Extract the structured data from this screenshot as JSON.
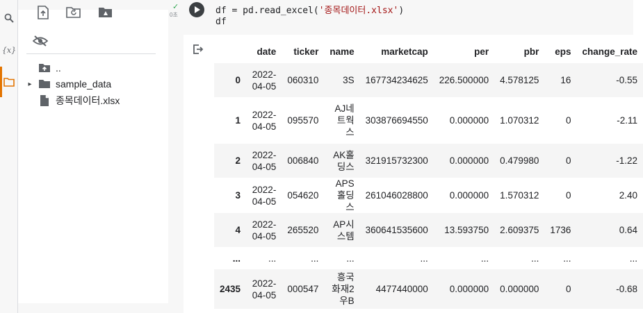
{
  "sidebar": {
    "rail": {
      "search_icon": "search-icon",
      "variables_label": "{x}",
      "files_icon": "folder-icon"
    },
    "toolbar": {
      "upload_icon": "upload-icon",
      "refresh_icon": "refresh-folder-icon",
      "drive_icon": "mount-drive-icon",
      "hide_icon": "eye-off-icon"
    },
    "tree": [
      {
        "label": "..",
        "icon": "folder-up-icon"
      },
      {
        "label": "sample_data",
        "icon": "folder-icon",
        "caret": "▸"
      },
      {
        "label": "종목데이터.xlsx",
        "icon": "file-icon"
      }
    ]
  },
  "cell": {
    "exec_check": "✓",
    "exec_time": "0초",
    "code_line_1_prefix": "df = pd.read_excel(",
    "code_line_1_string": "'종목데이터.xlsx'",
    "code_line_1_suffix": ")",
    "code_line_2": "df"
  },
  "table": {
    "columns": [
      "date",
      "ticker",
      "name",
      "marketcap",
      "per",
      "pbr",
      "eps",
      "change_rate"
    ],
    "rows": [
      {
        "index": "0",
        "date": "2022-04-05",
        "ticker": "060310",
        "name": "3S",
        "marketcap": "167734234625",
        "per": "226.500000",
        "pbr": "4.578125",
        "eps": "16",
        "change_rate": "-0.55"
      },
      {
        "index": "1",
        "date": "2022-04-05",
        "ticker": "095570",
        "name": "AJ네트웍스",
        "marketcap": "303876694550",
        "per": "0.000000",
        "pbr": "1.070312",
        "eps": "0",
        "change_rate": "-2.11"
      },
      {
        "index": "2",
        "date": "2022-04-05",
        "ticker": "006840",
        "name": "AK홀딩스",
        "marketcap": "321915732300",
        "per": "0.000000",
        "pbr": "0.479980",
        "eps": "0",
        "change_rate": "-1.22"
      },
      {
        "index": "3",
        "date": "2022-04-05",
        "ticker": "054620",
        "name": "APS홀딩스",
        "marketcap": "261046028800",
        "per": "0.000000",
        "pbr": "1.570312",
        "eps": "0",
        "change_rate": "2.40"
      },
      {
        "index": "4",
        "date": "2022-04-05",
        "ticker": "265520",
        "name": "AP시스템",
        "marketcap": "360641535600",
        "per": "13.593750",
        "pbr": "2.609375",
        "eps": "1736",
        "change_rate": "0.64"
      },
      {
        "index": "...",
        "date": "...",
        "ticker": "...",
        "name": "...",
        "marketcap": "...",
        "per": "...",
        "pbr": "...",
        "eps": "...",
        "change_rate": "..."
      },
      {
        "index": "2435",
        "date": "2022-04-05",
        "ticker": "000547",
        "name": "흥국화재2우B",
        "marketcap": "4477440000",
        "per": "0.000000",
        "pbr": "0.000000",
        "eps": "0",
        "change_rate": "-0.68"
      }
    ]
  }
}
